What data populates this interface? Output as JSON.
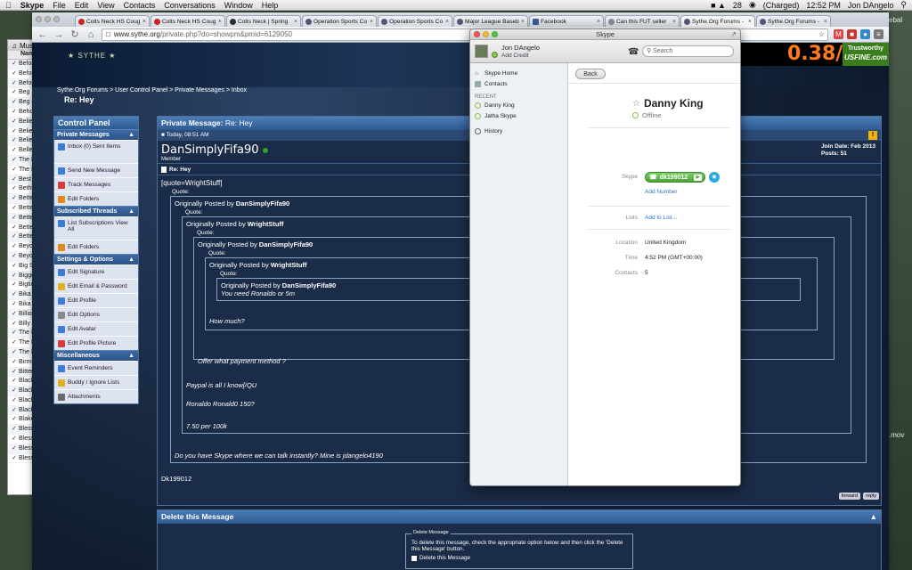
{
  "menubar": {
    "app": "Skype",
    "items": [
      "File",
      "Edit",
      "View",
      "Contacts",
      "Conversations",
      "Window",
      "Help"
    ],
    "badge": "28",
    "battery": "(Charged)",
    "time": "12:52 PM",
    "user": "Jon DAngelo"
  },
  "desktop": {
    "label_top": "ebal",
    "label_file": ".mov"
  },
  "music": {
    "title": "Music",
    "col_name": "Name",
    "rows": [
      "Before",
      "Before",
      "Before",
      "Beg",
      "Beg (A",
      "Behold",
      "Belief",
      "Belief |",
      "Believe",
      "Belle",
      "The Be",
      "The Be",
      "Best T",
      "Bethle",
      "Better",
      "Better",
      "Better",
      "Better",
      "Better",
      "Beyon",
      "Beyon",
      "Big Sh",
      "Bigger",
      "Bigtim",
      "Bika M",
      "Bika M",
      "Billion",
      "Billy S",
      "The Bi",
      "The Bi",
      "The Bi",
      "Birmin",
      "Bitter",
      "Black",
      "Black",
      "Black",
      "Black",
      "Blake",
      "Bless t",
      "Bless Y",
      "Blesse",
      "Blesse"
    ]
  },
  "browser": {
    "tabs": [
      {
        "title": "Colts Neck HS Coug",
        "fav": "r"
      },
      {
        "title": "Colts Neck HS Coug",
        "fav": "r"
      },
      {
        "title": "Colts Neck | Spring",
        "fav": "m"
      },
      {
        "title": "Operation Sports Co",
        "fav": "s"
      },
      {
        "title": "Operation Sports Co",
        "fav": "s"
      },
      {
        "title": "Major League Baseb",
        "fav": "s"
      },
      {
        "title": "Facebook",
        "fav": "f"
      },
      {
        "title": "Can this FUT seller",
        "fav": "q"
      },
      {
        "title": "Sythe.Org Forums -",
        "fav": "s"
      },
      {
        "title": "Sythe.Org Forums -",
        "fav": "s"
      }
    ],
    "url_host": "www.sythe.org",
    "url_path": "/private.php?do=showpm&pmid=6129050"
  },
  "ad": {
    "price": "0.38/M",
    "brand_top": "Trustworthy",
    "brand": "USFINE.com"
  },
  "breadcrumb": {
    "path": "Sythe.Org Forums > User Control Panel > Private Messages > Inbox",
    "current": "Re: Hey"
  },
  "control_panel": {
    "title": "Control Panel",
    "sections": [
      {
        "label": "Private Messages",
        "items": [
          "Inbox (0)  Sent Items",
          "Send New Message",
          "Track Messages",
          "Edit Folders"
        ]
      },
      {
        "label": "Subscribed Threads",
        "items": [
          "List Subscriptions  View All",
          "Edit Folders"
        ]
      },
      {
        "label": "Settings & Options",
        "items": [
          "Edit Signature",
          "Edit Email & Password",
          "Edit Profile",
          "Edit Options",
          "Edit Avatar",
          "Edit Profile Picture"
        ]
      },
      {
        "label": "Miscellaneous",
        "items": [
          "Event Reminders",
          "Buddy / Ignore Lists",
          "Attachments"
        ]
      }
    ],
    "colors": [
      "#3a7fd5",
      "#3a7fd5",
      "#d73a3a",
      "#e08a1e",
      "#3a7fd5",
      "#e08a1e",
      "#3a7fd5",
      "#e0b01e",
      "#3a7fd5",
      "#8a8a8a",
      "#3a7fd5",
      "#d73a3a",
      "#3a7fd5",
      "#e0b01e",
      "#6a6a6a"
    ]
  },
  "pm": {
    "title": "Private Message",
    "subject_title": "Re: Hey",
    "date": "Today, 08:51 AM",
    "sender": "DanSimplyFifa90",
    "role": "Member",
    "join": "Join Date: Feb 2013",
    "posts": "Posts: 51",
    "subject": "Re: Hey",
    "raw_quote": "[quote=WrightStuff]",
    "quote_label": "Quote:",
    "quotes": [
      {
        "by_prefix": "Originally Posted by",
        "by": "DanSimplyFifa90",
        "text": "Do you have Skype where we can talk instantly? Mine is jdangelo4190"
      },
      {
        "by_prefix": "Originally Posted by",
        "by": "WrightStuff",
        "text1": "Paypal is all I know[/QU",
        "text2": "Ronaldo Ronald0 150?",
        "text3": "7.50 per 100k"
      },
      {
        "by_prefix": "Originally Posted by",
        "by": "DanSimplyFifa90",
        "text": "Offer what payment method ?"
      },
      {
        "by_prefix": "Originally Posted by",
        "by": "WrightStuff",
        "text": "How much?"
      },
      {
        "by_prefix": "Originally Posted by",
        "by": "DanSimplyFifa90",
        "text": "You need Ronaldo or 5m"
      }
    ],
    "signature": "Dk199012",
    "forward": "forward",
    "reply": "reply"
  },
  "delete": {
    "title": "Delete this Message",
    "legend": "Delete Message",
    "text": "To delete this message, check the appropriate option below and then click the 'Delete this Message' button.",
    "checkbox": "Delete this Message"
  },
  "skype": {
    "title": "Skype",
    "me": "Jon DAngelo",
    "credit": "Add Credit",
    "search_placeholder": "Search",
    "nav": [
      "Skype Home",
      "Contacts"
    ],
    "recent_label": "RECENT",
    "recent": [
      "Danny King",
      "Jatha Skype"
    ],
    "history": "History",
    "back": "Back",
    "contact": {
      "name": "Danny King",
      "status": "Offline",
      "skype_label": "Skype",
      "skype_id": "dk199012",
      "add_number": "Add Number",
      "lists_label": "Lists",
      "add_list": "Add to List...",
      "location_label": "Location",
      "location": "United Kingdom",
      "time_label": "Time",
      "time": "4:52 PM (GMT+00:00)",
      "contacts_label": "Contacts",
      "contacts": "5"
    }
  }
}
